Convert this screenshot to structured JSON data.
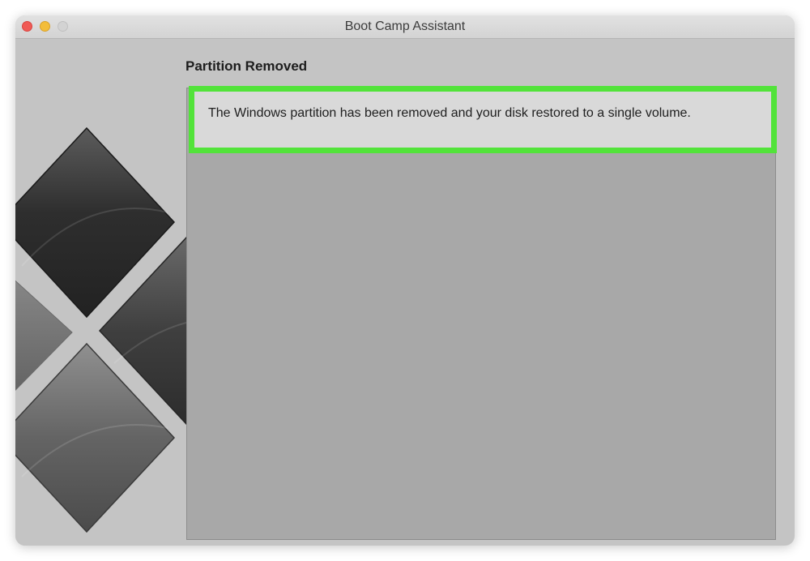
{
  "window": {
    "title": "Boot Camp Assistant"
  },
  "page": {
    "heading": "Partition Removed",
    "message": "The Windows partition has been removed and your disk restored to a single volume."
  },
  "colors": {
    "highlight_border": "#52e33a",
    "close_button": "#f05a55",
    "minimize_button": "#f3bd3b",
    "zoom_button": "#d3d3d3"
  },
  "icons": {
    "side_art": "boot-camp-windows-logo-icon"
  }
}
